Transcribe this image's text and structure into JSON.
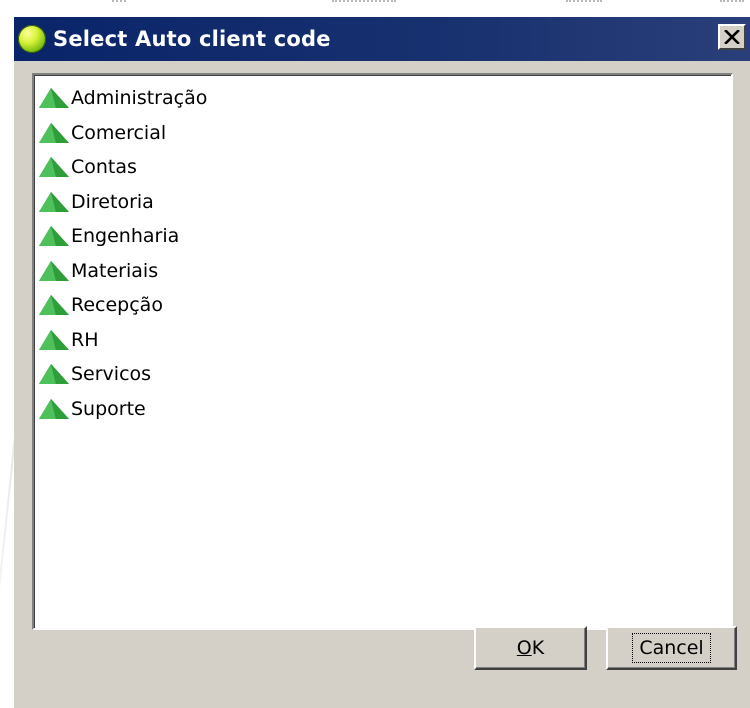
{
  "window": {
    "title": "Select Auto client code",
    "app_icon": "green-globe-icon",
    "close_icon": "close-icon"
  },
  "tree": {
    "item_icon": "green-pyramid-icon",
    "items": [
      {
        "label": "Administração"
      },
      {
        "label": "Comercial"
      },
      {
        "label": "Contas"
      },
      {
        "label": "Diretoria"
      },
      {
        "label": "Engenharia"
      },
      {
        "label": "Materiais"
      },
      {
        "label": "Recepção"
      },
      {
        "label": "RH"
      },
      {
        "label": "Servicos"
      },
      {
        "label": "Suporte"
      }
    ]
  },
  "buttons": {
    "ok_label": "OK",
    "cancel_label": "Cancel"
  },
  "colors": {
    "titlebar": "#0a246a",
    "dialog_face": "#d4d0c8",
    "icon_green": "#2e9e3a"
  }
}
